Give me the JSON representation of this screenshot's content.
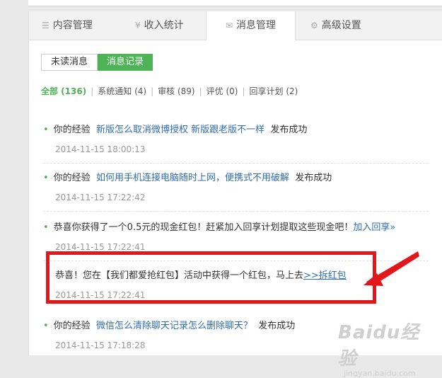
{
  "tabs": [
    {
      "label": "内容管理",
      "icon": "document-icon",
      "glyph": "☰"
    },
    {
      "label": "收入统计",
      "icon": "yen-icon",
      "glyph": "¥"
    },
    {
      "label": "消息管理",
      "icon": "mail-icon",
      "glyph": "✉"
    },
    {
      "label": "高级设置",
      "icon": "gear-icon",
      "glyph": "⚙"
    }
  ],
  "subtabs": {
    "unread": "未读消息",
    "records": "消息记录"
  },
  "filters": [
    {
      "label": "全部 (136)"
    },
    {
      "label": "系统通知 (4)"
    },
    {
      "label": "审核 (89)"
    },
    {
      "label": "评优 (0)"
    },
    {
      "label": "回享计划 (2)"
    }
  ],
  "messages": [
    {
      "prefix": "你的经验",
      "link": "新版怎么取消微博授权 新版跟老版不一样",
      "suffix": "发布成功",
      "time": "2014-11-15 18:00:13"
    },
    {
      "prefix": "你的经验",
      "link": "如何用手机连接电脑随时上网，便携式不用破解",
      "suffix": "发布成功",
      "time": "2014-11-15 17:22:42"
    },
    {
      "prefix": "恭喜你获得了一个0.5元的现金红包！赶紧加入回享计划提取这些现金吧！",
      "link": "加入回享»",
      "suffix": "",
      "time": "2014-11-15 17:22:41"
    },
    {
      "prefix": "恭喜！您在【我们都爱抢红包】活动中获得一个红包，马上去",
      "link": ">>拆红包",
      "suffix": "",
      "time": "2014-11-15 17:22:41"
    },
    {
      "prefix": "你的经验",
      "link": "微信怎么清除聊天记录怎么删除聊天？",
      "suffix": "发布成功",
      "time": "2014-11-15 17:18:28"
    }
  ],
  "watermark": {
    "logo": "Baidu经验",
    "url": "jingyan.baidu.com"
  },
  "colors": {
    "accent": "#4eb356",
    "link": "#2f6db0",
    "highlight": "#e3161b"
  }
}
